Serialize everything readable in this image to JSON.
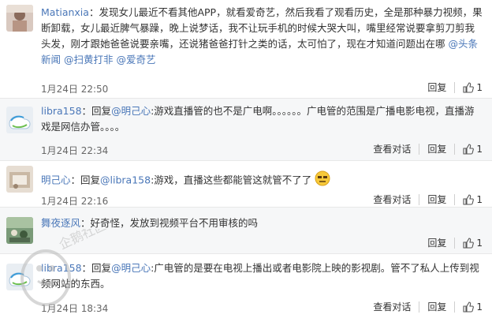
{
  "comments": [
    {
      "user": "Matianxia",
      "text": "：发现女儿最近不看其他APP，就看爱奇艺，然后我看了观看历史，全是那种暴力视频，果断卸载，女儿最近脾气暴躁，晚上说梦话，我不让玩手机的时候大哭大叫，嘴里经常说要拿剪刀剪我头发，刚才跟她爸爸说要亲嘴，还说猪爸爸打针之类的话，太可怕了，现在才知道问题出在哪 ",
      "mentions": [
        "@头条新闻",
        "@扫黄打非",
        "@爱奇艺"
      ],
      "time": "1月24日 22:50",
      "reply_label": "回复",
      "likes": "1"
    },
    {
      "user": "libra158",
      "reply_prefix": "：回复",
      "reply_to": "@明己心",
      "text": ":游戏直播管的也不是广电啊。。。。。。广电管的范围是广播电影电视，直播游戏是网信办管。。。。",
      "time": "1月24日 22:34",
      "view_label": "查看对话",
      "reply_label": "回复",
      "likes": "1"
    },
    {
      "user": "明己心",
      "reply_prefix": "：回复",
      "reply_to": "@libra158",
      "text": ":游戏，直播这些都能管这就管不了了",
      "time": "1月24日 22:16",
      "view_label": "查看对话",
      "reply_label": "回复",
      "likes": "1"
    },
    {
      "user": "舞夜逐风",
      "text": "：好奇怪，发放到视频平台不用审核的吗",
      "time": "",
      "reply_label": "回复",
      "likes": "1"
    },
    {
      "user": "libra158",
      "reply_prefix": "：回复",
      "reply_to": "@明己心",
      "text": ":广电管的是要在电视上播出或者电影院上映的影视剧。管不了私人上传到视频网站的东西。",
      "time": "1月24日 18:34",
      "view_label": "查看对话",
      "reply_label": "回复",
      "likes": "1"
    }
  ],
  "watermark": "企鹅社区",
  "colors": {
    "link": "#4a77b8",
    "divider": "#e8e8e8",
    "alt_bg": "#f6f7f8"
  }
}
